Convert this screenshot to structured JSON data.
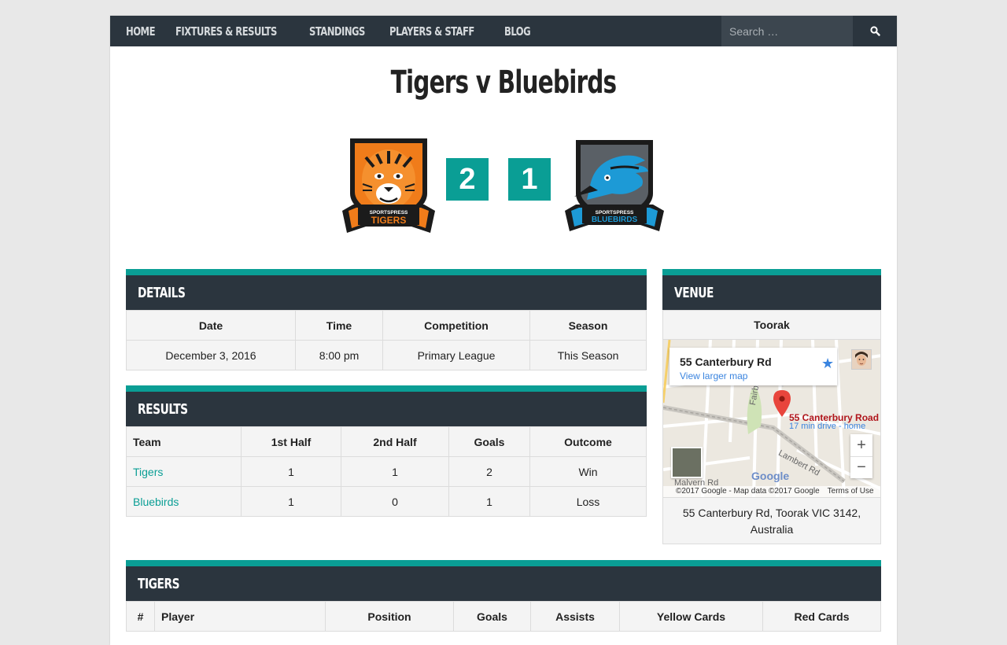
{
  "nav": {
    "items": [
      "Home",
      "Fixtures & Results",
      "Standings",
      "Players & Staff",
      "Blog"
    ],
    "search_placeholder": "Search …"
  },
  "event": {
    "title": "Tigers v Bluebirds",
    "home": {
      "name": "Tigers",
      "logo_top": "SPORTSPRESS",
      "logo_name": "TIGERS",
      "score": "2"
    },
    "away": {
      "name": "Bluebirds",
      "logo_top": "SPORTSPRESS",
      "logo_name": "BLUEBIRDS",
      "score": "1"
    }
  },
  "details": {
    "heading": "Details",
    "columns": [
      "Date",
      "Time",
      "Competition",
      "Season"
    ],
    "values": [
      "December 3, 2016",
      "8:00 pm",
      "Primary League",
      "This Season"
    ]
  },
  "results": {
    "heading": "Results",
    "columns": [
      "Team",
      "1st Half",
      "2nd Half",
      "Goals",
      "Outcome"
    ],
    "rows": [
      [
        "Tigers",
        "1",
        "1",
        "2",
        "Win"
      ],
      [
        "Bluebirds",
        "1",
        "0",
        "1",
        "Loss"
      ]
    ]
  },
  "venue": {
    "heading": "Venue",
    "name": "Toorak",
    "address": "55 Canterbury Rd, Toorak VIC 3142, Australia",
    "map": {
      "card_title": "55 Canterbury Rd",
      "card_link": "View larger map",
      "pin_label": "55 Canterbury Road",
      "pin_sub": "17 min drive - home",
      "roads": [
        "Fairbairn Rd",
        "Lambert Rd",
        "Malvern Rd"
      ],
      "google": "Google",
      "footer": "©2017 Google - Map data ©2017 Google",
      "terms": "Terms of Use",
      "zoom_in": "+",
      "zoom_out": "−"
    }
  },
  "lineup": {
    "heading": "Tigers",
    "columns": [
      "#",
      "Player",
      "Position",
      "Goals",
      "Assists",
      "Yellow Cards",
      "Red Cards"
    ]
  },
  "colors": {
    "accent": "#0a9e95",
    "nav_bg": "#2b353e",
    "tigers_orange": "#f07c1a",
    "bluebirds_blue": "#1d9ad6"
  }
}
